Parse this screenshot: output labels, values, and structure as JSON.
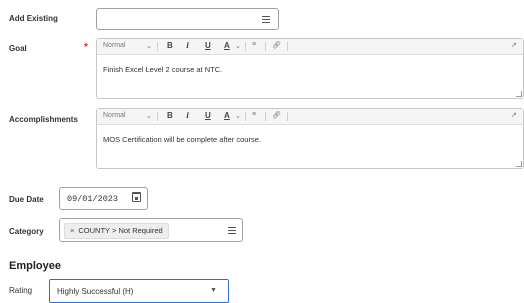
{
  "labels": {
    "add_existing": "Add Existing",
    "goal": "Goal",
    "required_star": "*",
    "accomplishments": "Accomplishments",
    "due_date": "Due Date",
    "category": "Category",
    "rating": "Rating"
  },
  "toolbar": {
    "style": "Normal",
    "bold": "B",
    "italic": "I",
    "underline": "U",
    "color": "A"
  },
  "fields": {
    "goal_text": "Finish Excel Level 2 course at NTC.",
    "accomplishments_text": "MOS Certification will be complete after course.",
    "due_date": "09/01/2023",
    "category_tag": "COUNTY > Not Required",
    "rating_value": "Highly Successful (H)"
  },
  "section_title": "Employee",
  "colors": {
    "required": "#de2e21",
    "focus_border": "#2b6fd6"
  },
  "icons": [
    "list-icon",
    "calendar-icon",
    "expand-icon",
    "link-icon",
    "close-icon",
    "caret-down-icon"
  ]
}
